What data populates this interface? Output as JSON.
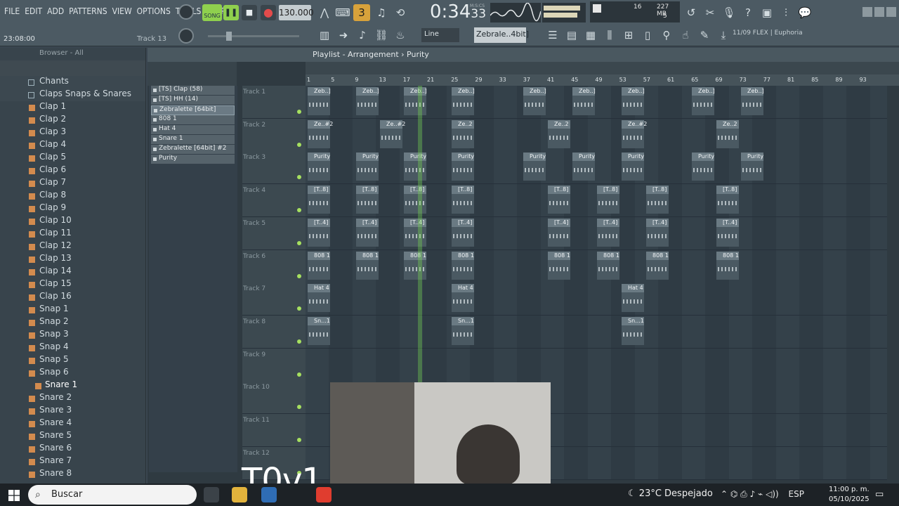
{
  "menu": [
    "FILE",
    "EDIT",
    "ADD",
    "PATTERNS",
    "VIEW",
    "OPTIONS",
    "TOOLS",
    "HELP"
  ],
  "transport": {
    "mode": "SONG",
    "tempo": "130.000",
    "time": "0:34",
    "time_sub": "33",
    "time_label": "M:S:CS",
    "pattern_num": "3"
  },
  "cpu": {
    "cores": "16",
    "ram": "227 MB",
    "voices": "5"
  },
  "hints": {
    "left": "23:08:00",
    "right": "Track 13"
  },
  "toolbar2": {
    "snap": "Line",
    "pattern": "Zebrale..4bit]",
    "plugin": "11/09  FLEX | Euphoria"
  },
  "browser": {
    "title": "Browser - All",
    "items": [
      {
        "label": "Chants",
        "folder": true
      },
      {
        "label": "Claps Snaps & Snares",
        "folder": true
      },
      {
        "label": "Clap 1"
      },
      {
        "label": "Clap 2"
      },
      {
        "label": "Clap 3"
      },
      {
        "label": "Clap 4"
      },
      {
        "label": "Clap 5"
      },
      {
        "label": "Clap 6"
      },
      {
        "label": "Clap 7"
      },
      {
        "label": "Clap 8"
      },
      {
        "label": "Clap 9"
      },
      {
        "label": "Clap 10"
      },
      {
        "label": "Clap 11"
      },
      {
        "label": "Clap 12"
      },
      {
        "label": "Clap 13"
      },
      {
        "label": "Clap 14"
      },
      {
        "label": "Clap 15"
      },
      {
        "label": "Clap 16"
      },
      {
        "label": "Snap 1"
      },
      {
        "label": "Snap 2"
      },
      {
        "label": "Snap 3"
      },
      {
        "label": "Snap 4"
      },
      {
        "label": "Snap 5"
      },
      {
        "label": "Snap 6"
      },
      {
        "label": "Snare 1",
        "selected": true
      },
      {
        "label": "Snare 2"
      },
      {
        "label": "Snare 3"
      },
      {
        "label": "Snare 4"
      },
      {
        "label": "Snare 5"
      },
      {
        "label": "Snare 6"
      },
      {
        "label": "Snare 7"
      },
      {
        "label": "Snare 8"
      }
    ]
  },
  "playlist": {
    "title": "Playlist - Arrangement › Purity",
    "patterns": [
      "[TS] Clap (58)",
      "[TS] HH (14)",
      "Zebralette [64bit]",
      "808 1",
      "Hat 4",
      "Snare 1",
      "Zebralette [64bit] #2",
      "Purity"
    ],
    "ruler": [
      "1",
      "5",
      "9",
      "13",
      "17",
      "21",
      "25",
      "29",
      "33",
      "37",
      "41",
      "45",
      "49",
      "53",
      "57",
      "61",
      "65",
      "69",
      "73",
      "77",
      "81",
      "85",
      "89",
      "93"
    ],
    "tracks": [
      {
        "name": "Track 1",
        "clips": [
          {
            "label": "Zeb..]"
          },
          {
            "label": "Zeb..]"
          },
          {
            "label": "Zeb..]"
          },
          {
            "label": "Zeb..]"
          },
          {
            "label": "Zeb..]"
          },
          {
            "label": "Zeb..]"
          },
          {
            "label": "Zeb..]"
          },
          {
            "label": "Zeb..]"
          },
          {
            "label": "Zeb..]"
          }
        ]
      },
      {
        "name": "Track 2",
        "clips": [
          {
            "label": "Ze..#2"
          },
          {
            "label": "Ze..#2"
          },
          {
            "label": "Ze..2"
          },
          {
            "label": "Ze..2"
          },
          {
            "label": "Ze..#2"
          },
          {
            "label": "Ze..2"
          }
        ]
      },
      {
        "name": "Track 3",
        "clips": [
          {
            "label": "Purity"
          },
          {
            "label": "Purity"
          },
          {
            "label": "Purity"
          },
          {
            "label": "Purity"
          },
          {
            "label": "Purity"
          },
          {
            "label": "Purity"
          },
          {
            "label": "Purity"
          },
          {
            "label": "Purity"
          },
          {
            "label": "Purity"
          }
        ]
      },
      {
        "name": "Track 4",
        "clips": [
          {
            "label": "[T..8]"
          },
          {
            "label": "[T..8]"
          },
          {
            "label": "[T..8]"
          },
          {
            "label": "[T..8]"
          },
          {
            "label": "[T..8]"
          },
          {
            "label": "[T..8]"
          },
          {
            "label": "[T..8]"
          },
          {
            "label": "[T..8]"
          }
        ]
      },
      {
        "name": "Track 5",
        "clips": [
          {
            "label": "[T..4]"
          },
          {
            "label": "[T..4]"
          },
          {
            "label": "[T..4]"
          },
          {
            "label": "[T..4]"
          },
          {
            "label": "[T..4]"
          },
          {
            "label": "[T..4]"
          },
          {
            "label": "[T..4]"
          },
          {
            "label": "[T..4]"
          }
        ]
      },
      {
        "name": "Track 6",
        "clips": [
          {
            "label": "808 1"
          },
          {
            "label": "808 1"
          },
          {
            "label": "808 1"
          },
          {
            "label": "808 1"
          },
          {
            "label": "808 1"
          },
          {
            "label": "808 1"
          },
          {
            "label": "808 1"
          },
          {
            "label": "808 1"
          }
        ]
      },
      {
        "name": "Track 7",
        "clips": [
          {
            "label": "Hat 4"
          },
          {
            "label": "Hat 4"
          },
          {
            "label": "Hat 4"
          }
        ]
      },
      {
        "name": "Track 8",
        "clips": [
          {
            "label": "Sn...1"
          },
          {
            "label": "Sn...1"
          },
          {
            "label": "Sn...1"
          }
        ]
      },
      {
        "name": "Track 9",
        "clips": []
      },
      {
        "name": "Track 10",
        "clips": []
      },
      {
        "name": "Track 11",
        "clips": []
      },
      {
        "name": "Track 12",
        "clips": []
      }
    ]
  },
  "overlay_text": "T0v1",
  "taskbar": {
    "search": "Buscar",
    "weather": "23°C  Despejado",
    "lang": "ESP",
    "time": "11:00 p. m.",
    "date": "05/10/2025",
    "notif": "3"
  }
}
